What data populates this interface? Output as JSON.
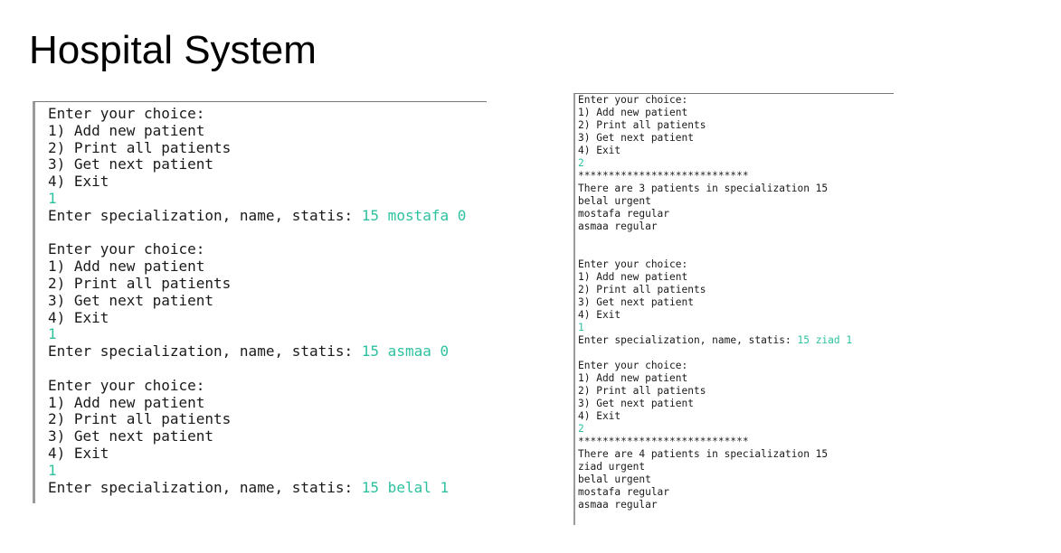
{
  "slide": {
    "title": "Hospital System"
  },
  "colors": {
    "input_text": "#2ec1a0",
    "output_text": "#1a1a1a"
  },
  "left_terminal": {
    "lines": [
      {
        "text": "Enter your choice:"
      },
      {
        "text": "1) Add new patient"
      },
      {
        "text": "2) Print all patients"
      },
      {
        "text": "3) Get next patient"
      },
      {
        "text": "4) Exit"
      },
      {
        "input": "1"
      },
      {
        "text": "Enter specialization, name, statis: ",
        "input": "15 mostafa 0"
      },
      {
        "text": ""
      },
      {
        "text": "Enter your choice:"
      },
      {
        "text": "1) Add new patient"
      },
      {
        "text": "2) Print all patients"
      },
      {
        "text": "3) Get next patient"
      },
      {
        "text": "4) Exit"
      },
      {
        "input": "1"
      },
      {
        "text": "Enter specialization, name, statis: ",
        "input": "15 asmaa 0"
      },
      {
        "text": ""
      },
      {
        "text": "Enter your choice:"
      },
      {
        "text": "1) Add new patient"
      },
      {
        "text": "2) Print all patients"
      },
      {
        "text": "3) Get next patient"
      },
      {
        "text": "4) Exit"
      },
      {
        "input": "1"
      },
      {
        "text": "Enter specialization, name, statis: ",
        "input": "15 belal 1"
      }
    ]
  },
  "right_terminal": {
    "lines": [
      {
        "text": "Enter your choice:"
      },
      {
        "text": "1) Add new patient"
      },
      {
        "text": "2) Print all patients"
      },
      {
        "text": "3) Get next patient"
      },
      {
        "text": "4) Exit"
      },
      {
        "input": "2"
      },
      {
        "text": "****************************"
      },
      {
        "text": "There are 3 patients in specialization 15"
      },
      {
        "text": "belal urgent"
      },
      {
        "text": "mostafa regular"
      },
      {
        "text": "asmaa regular"
      },
      {
        "text": ""
      },
      {
        "text": ""
      },
      {
        "text": "Enter your choice:"
      },
      {
        "text": "1) Add new patient"
      },
      {
        "text": "2) Print all patients"
      },
      {
        "text": "3) Get next patient"
      },
      {
        "text": "4) Exit"
      },
      {
        "input": "1"
      },
      {
        "text": "Enter specialization, name, statis: ",
        "input": "15 ziad 1"
      },
      {
        "text": ""
      },
      {
        "text": "Enter your choice:"
      },
      {
        "text": "1) Add new patient"
      },
      {
        "text": "2) Print all patients"
      },
      {
        "text": "3) Get next patient"
      },
      {
        "text": "4) Exit"
      },
      {
        "input": "2"
      },
      {
        "text": "****************************"
      },
      {
        "text": "There are 4 patients in specialization 15"
      },
      {
        "text": "ziad urgent"
      },
      {
        "text": "belal urgent"
      },
      {
        "text": "mostafa regular"
      },
      {
        "text": "asmaa regular"
      }
    ]
  }
}
